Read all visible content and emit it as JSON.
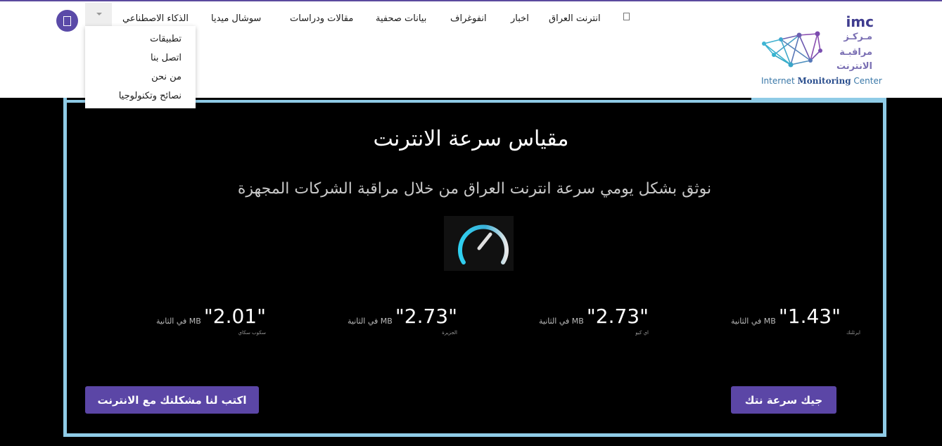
{
  "logo": {
    "abbr": "imc",
    "line1": "مـركـز",
    "line2": "مراقبـة",
    "line3": "الانترنت",
    "en_prefix": "Internet ",
    "en_bold": "Monitoring",
    "en_suffix": " Center"
  },
  "nav": {
    "items": [
      "انترنت العراق",
      "اخبار",
      "انفوغراف",
      "بيانات صحفية",
      "مقالات ودراسات",
      "سوشال ميديا",
      "الذكاء الاصطناعي"
    ],
    "dropdown": [
      "تطبيقات",
      "اتصل بنا",
      "من نحن",
      "نصائح وتكنولوجيا"
    ]
  },
  "hero": {
    "title": "مقياس سرعة الانترنت",
    "subtitle": "نوثق بشكل يومي سرعة انترنت العراق من خلال مراقبة الشركات المجهزة"
  },
  "stats": [
    {
      "value": "\"1.43\"",
      "unit": "MB في الثانية",
      "isp": "ايرثلنك"
    },
    {
      "value": "\"2.73\"",
      "unit": "MB في الثانية",
      "isp": "اي كيو"
    },
    {
      "value": "\"2.73\"",
      "unit": "MB في الثانية",
      "isp": "الجزيرة"
    },
    {
      "value": "\"2.01\"",
      "unit": "MB في الثانية",
      "isp": "سكوب سكاي"
    }
  ],
  "buttons": {
    "speed": "جيك سرعة نتك",
    "report": "اكتب لنا مشكلتك مع الانترنت"
  },
  "colors": {
    "accent": "#5b46a6",
    "frame": "#8fcbe6",
    "background": "#000000"
  }
}
